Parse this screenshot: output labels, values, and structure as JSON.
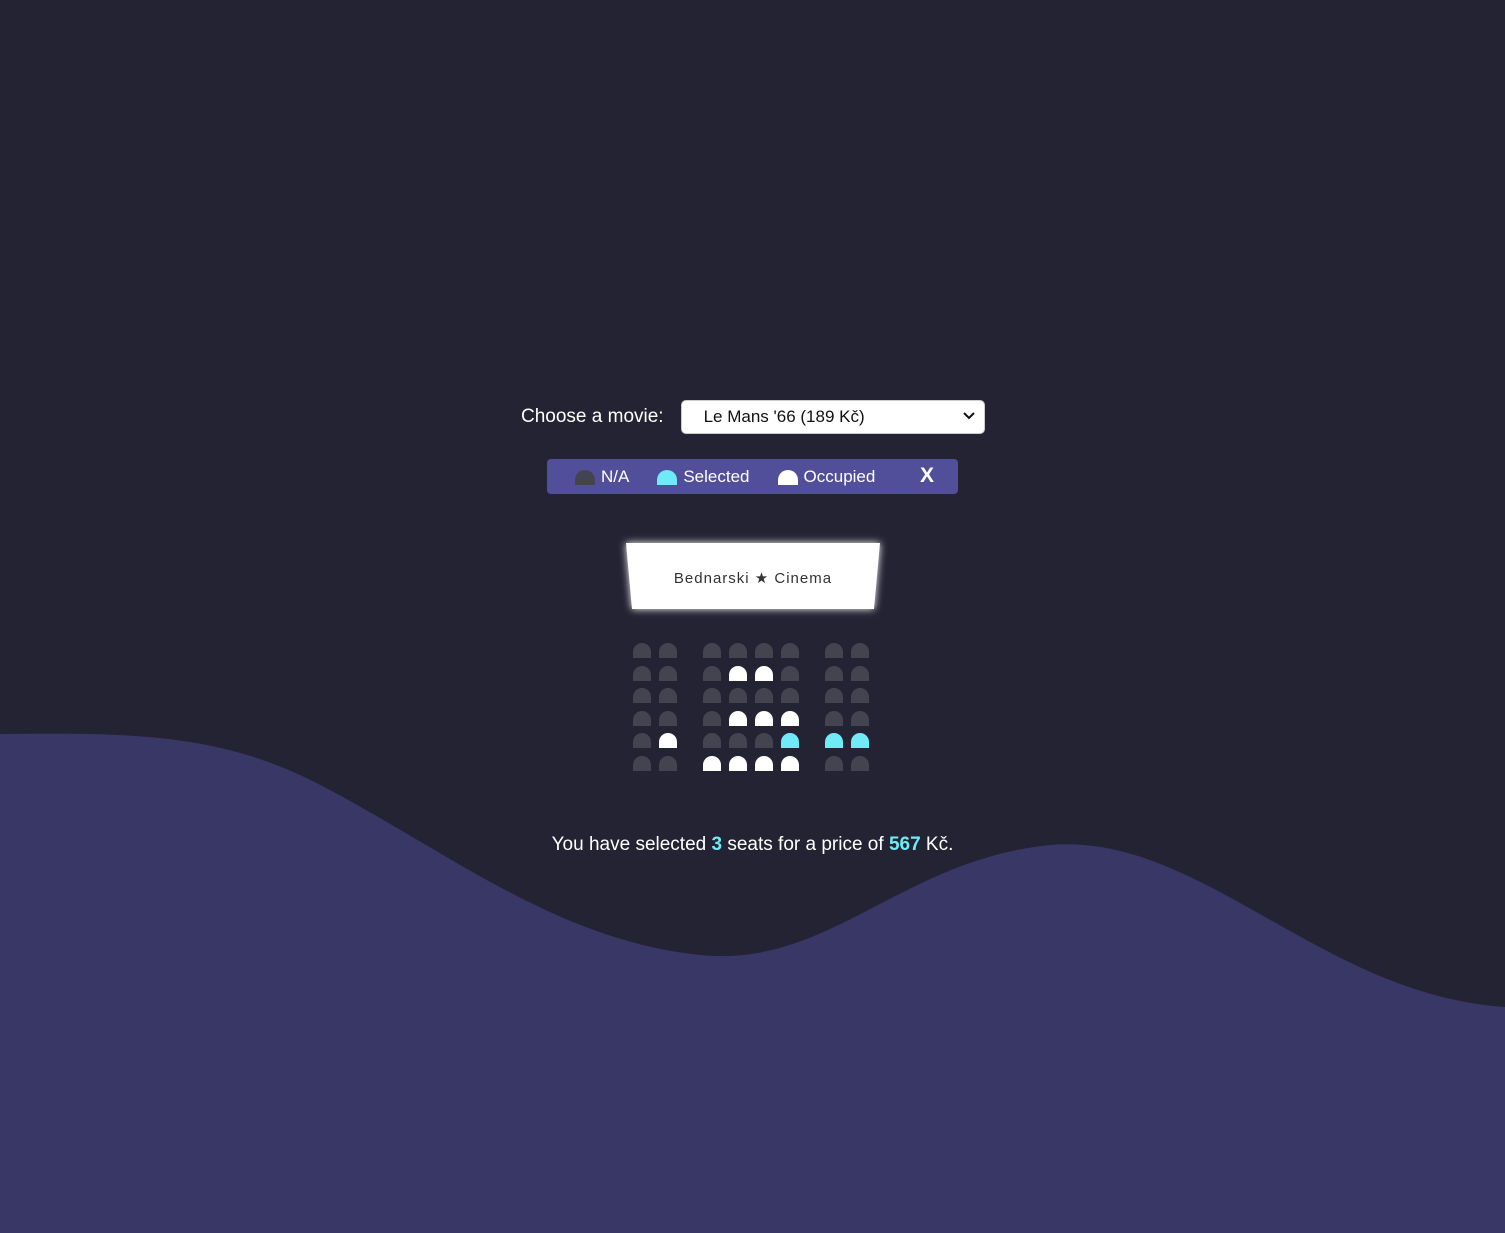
{
  "movie": {
    "label": "Choose a movie:",
    "selected": "Le Mans '66 (189 Kč)"
  },
  "legend": {
    "items": [
      {
        "label": "N/A",
        "state": "na",
        "color": "#444451"
      },
      {
        "label": "Selected",
        "state": "selected",
        "color": "#6feaf6"
      },
      {
        "label": "Occupied",
        "state": "occupied",
        "color": "#ffffff"
      }
    ],
    "close_label": "X"
  },
  "screen": {
    "title": "Bednarski ★ Cinema"
  },
  "seats": {
    "rows": [
      [
        "na",
        "na",
        "na",
        "na",
        "na",
        "na",
        "na",
        "na"
      ],
      [
        "na",
        "na",
        "na",
        "occupied",
        "occupied",
        "na",
        "na",
        "na"
      ],
      [
        "na",
        "na",
        "na",
        "na",
        "na",
        "na",
        "na",
        "na"
      ],
      [
        "na",
        "na",
        "na",
        "occupied",
        "occupied",
        "occupied",
        "na",
        "na"
      ],
      [
        "na",
        "occupied",
        "na",
        "na",
        "na",
        "selected",
        "selected",
        "selected"
      ],
      [
        "na",
        "na",
        "occupied",
        "occupied",
        "occupied",
        "occupied",
        "na",
        "na"
      ]
    ]
  },
  "summary": {
    "prefix": "You have selected",
    "count": "3",
    "middle": "seats for a price of",
    "price": "567",
    "currency": "Kč."
  },
  "colors": {
    "background": "#242333",
    "wave": "#383766",
    "legend_bg": "#514f99",
    "accent": "#6feaf6"
  }
}
